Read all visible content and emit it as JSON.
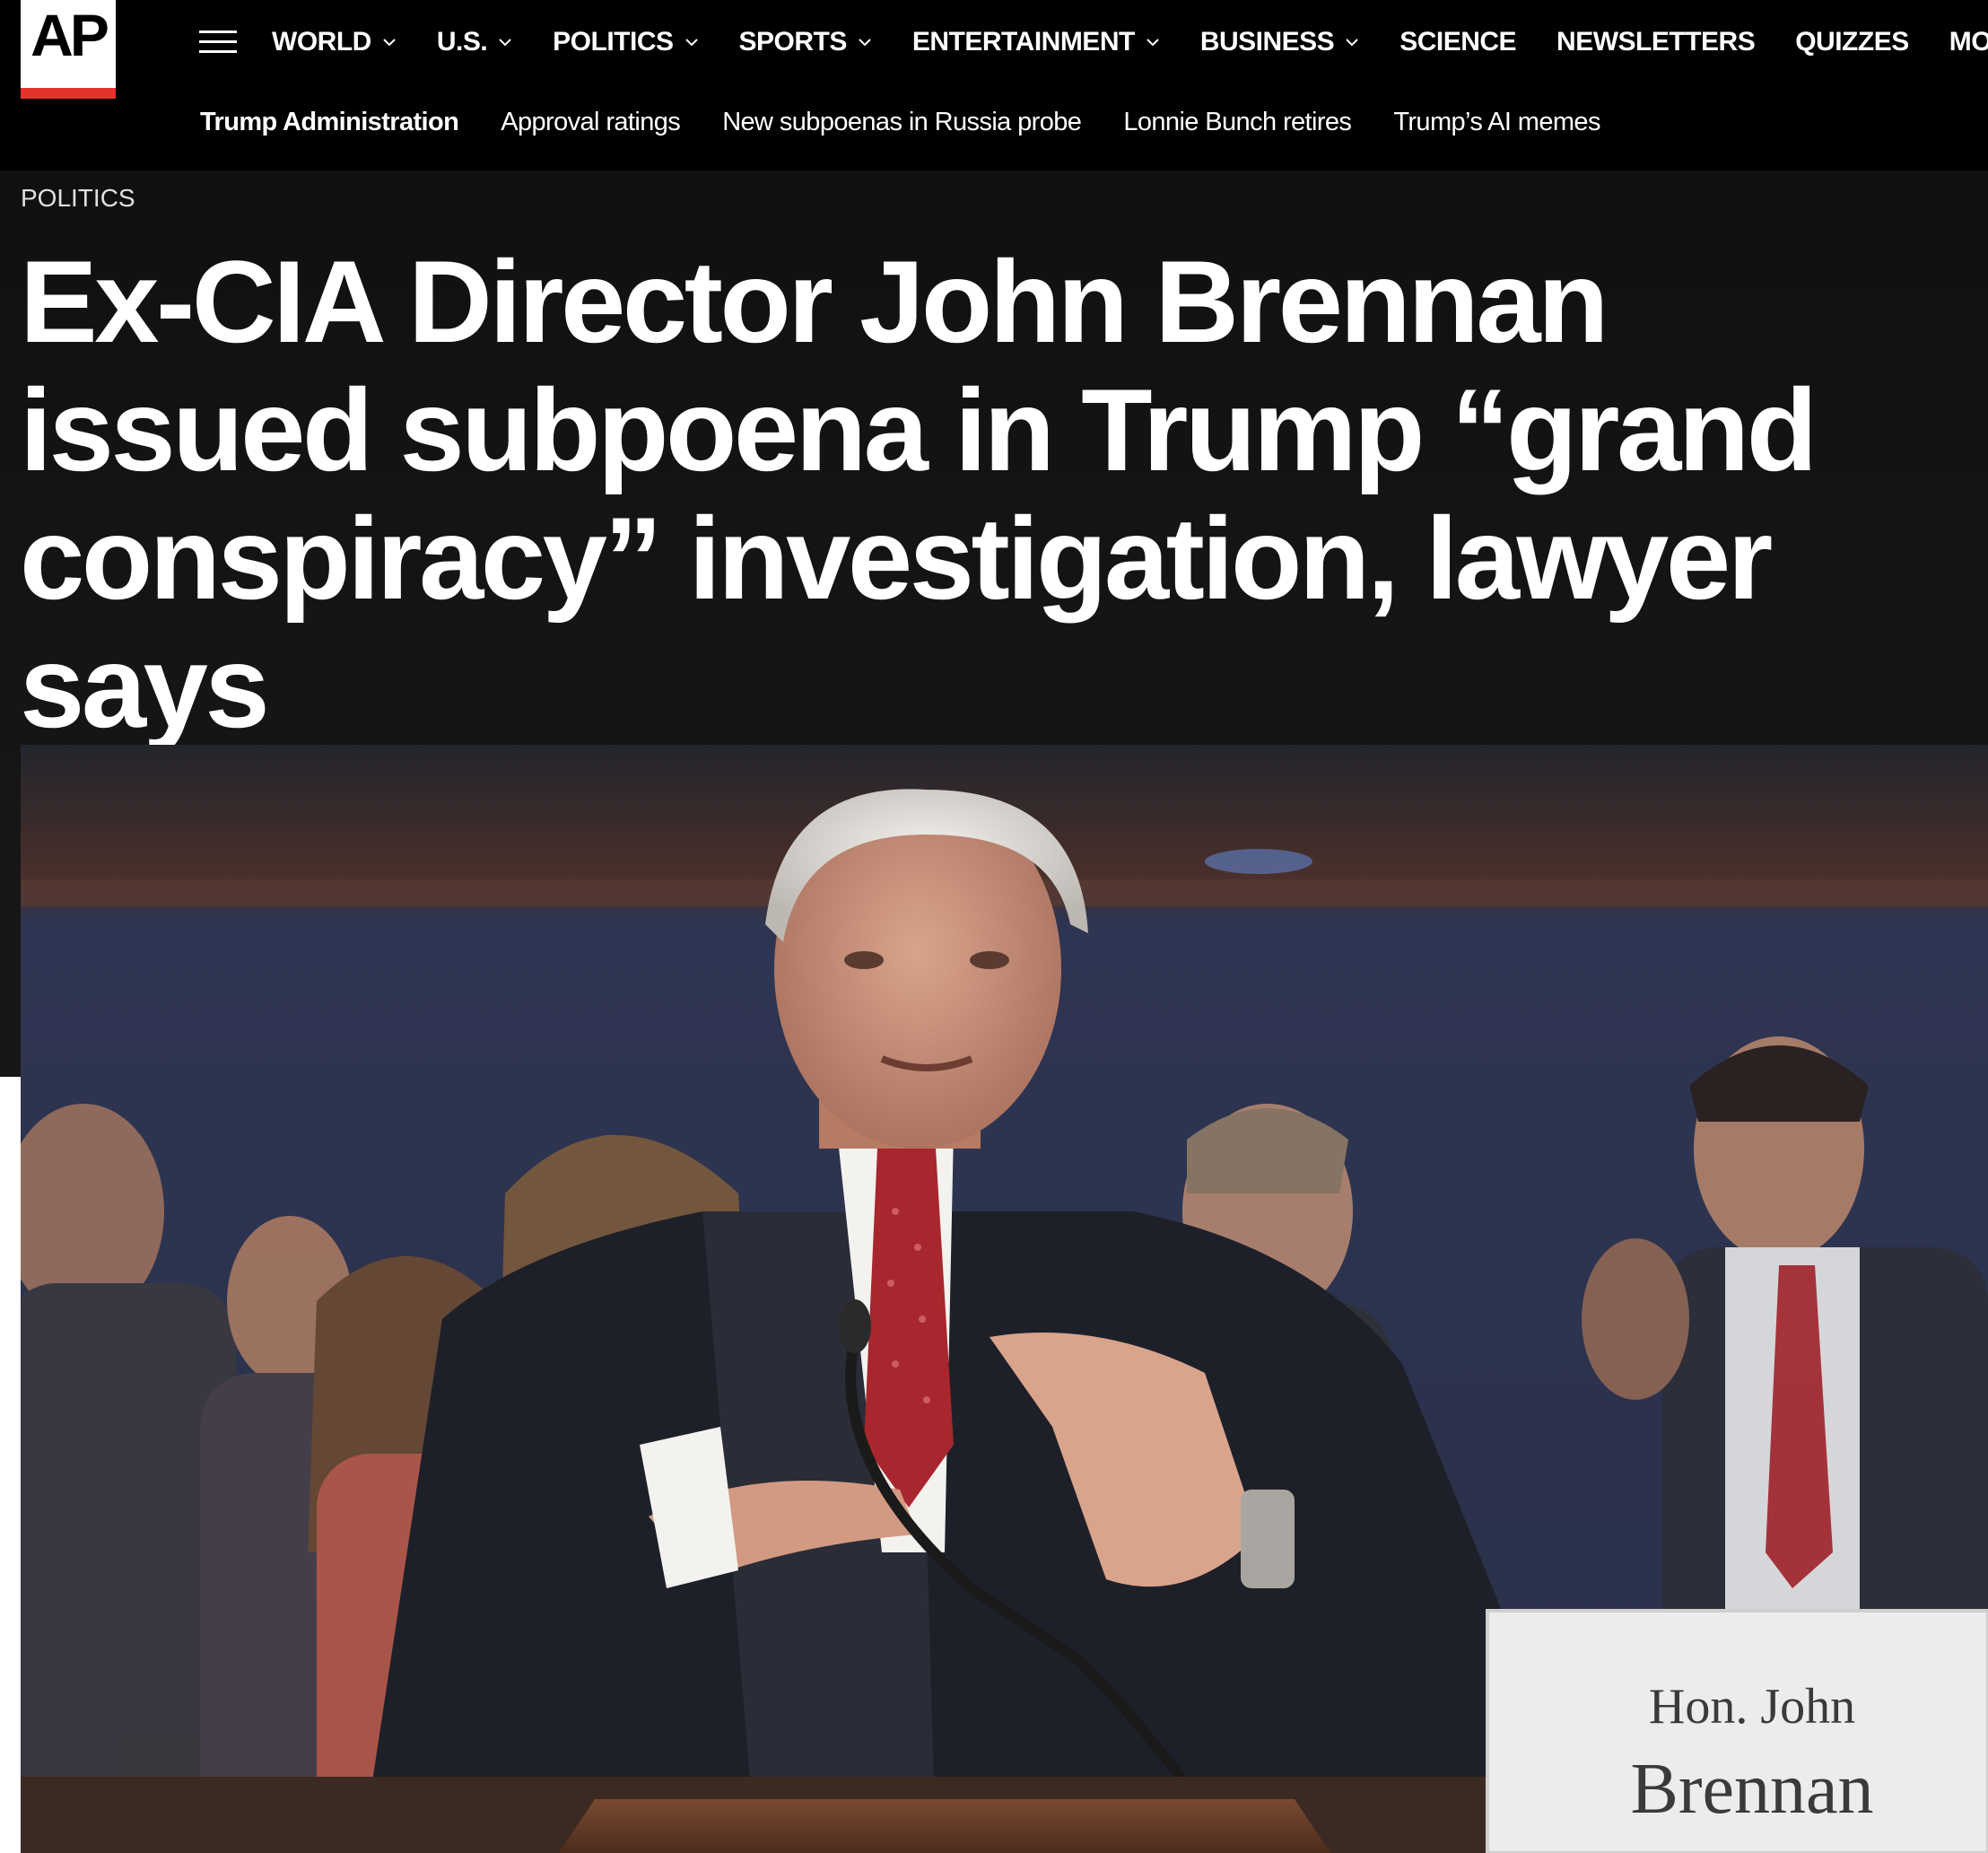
{
  "brand": {
    "logo_text": "AP",
    "accent_color": "#e4332d",
    "header_background": "#000000"
  },
  "header": {
    "menu_icon": "hamburger-menu-icon",
    "nav": [
      {
        "label": "WORLD",
        "has_dropdown": true
      },
      {
        "label": "U.S.",
        "has_dropdown": true
      },
      {
        "label": "POLITICS",
        "has_dropdown": true
      },
      {
        "label": "SPORTS",
        "has_dropdown": true
      },
      {
        "label": "ENTERTAINMENT",
        "has_dropdown": true
      },
      {
        "label": "BUSINESS",
        "has_dropdown": true
      },
      {
        "label": "SCIENCE",
        "has_dropdown": false
      },
      {
        "label": "NEWSLETTERS",
        "has_dropdown": false
      },
      {
        "label": "QUIZZES",
        "has_dropdown": false
      },
      {
        "label": "MORE",
        "has_dropdown": true
      }
    ],
    "trending": [
      {
        "label": "Trump Administration",
        "active": true
      },
      {
        "label": "Approval ratings",
        "active": false
      },
      {
        "label": "New subpoenas in Russia probe",
        "active": false
      },
      {
        "label": "Lonnie Bunch retires",
        "active": false
      },
      {
        "label": "Trump’s AI memes",
        "active": false
      }
    ]
  },
  "article": {
    "section": "POLITICS",
    "headline": "Ex-CIA Director John Brennan issued subpoena in Trump “grand conspiracy” investigation, lawyer says",
    "photo": {
      "placard_line1": "Hon. John",
      "placard_line2": "Brennan"
    }
  }
}
